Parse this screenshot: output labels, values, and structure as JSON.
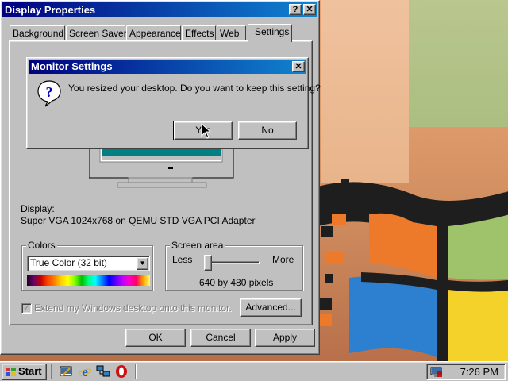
{
  "window": {
    "title": "Display Properties",
    "help_btn": "?",
    "close_btn": "✕"
  },
  "tabs": [
    {
      "label": "Background"
    },
    {
      "label": "Screen Saver"
    },
    {
      "label": "Appearance"
    },
    {
      "label": "Effects"
    },
    {
      "label": "Web"
    },
    {
      "label": "Settings"
    }
  ],
  "settings": {
    "display_label": "Display:",
    "display_value": "Super VGA 1024x768 on QEMU STD VGA PCI Adapter",
    "colors_title": "Colors",
    "colors_value": "True Color (32 bit)",
    "screen_area_title": "Screen area",
    "less_label": "Less",
    "more_label": "More",
    "resolution_text": "640 by 480 pixels",
    "resolution_slider_fraction": 0.0,
    "extend_label": "Extend my Windows desktop onto this monitor.",
    "extend_checked": true,
    "advanced_label": "Advanced..."
  },
  "buttons": {
    "ok": "OK",
    "cancel": "Cancel",
    "apply": "Apply"
  },
  "dialog": {
    "title": "Monitor Settings",
    "close_btn": "✕",
    "message": "You resized your desktop.  Do you want to keep this setting?",
    "yes_label": "Yes",
    "no_label": "No",
    "icon": "question-icon"
  },
  "taskbar": {
    "start_label": "Start",
    "quick_launch": [
      "desktop-icon",
      "internet-explorer-icon",
      "network-icon",
      "opera-icon"
    ],
    "clock": "7:26 PM",
    "tray_icon": "display-settings-icon"
  },
  "colors": {
    "title_active_start": "#000080",
    "title_active_end": "#1084d0",
    "face": "#c0c0c0"
  }
}
